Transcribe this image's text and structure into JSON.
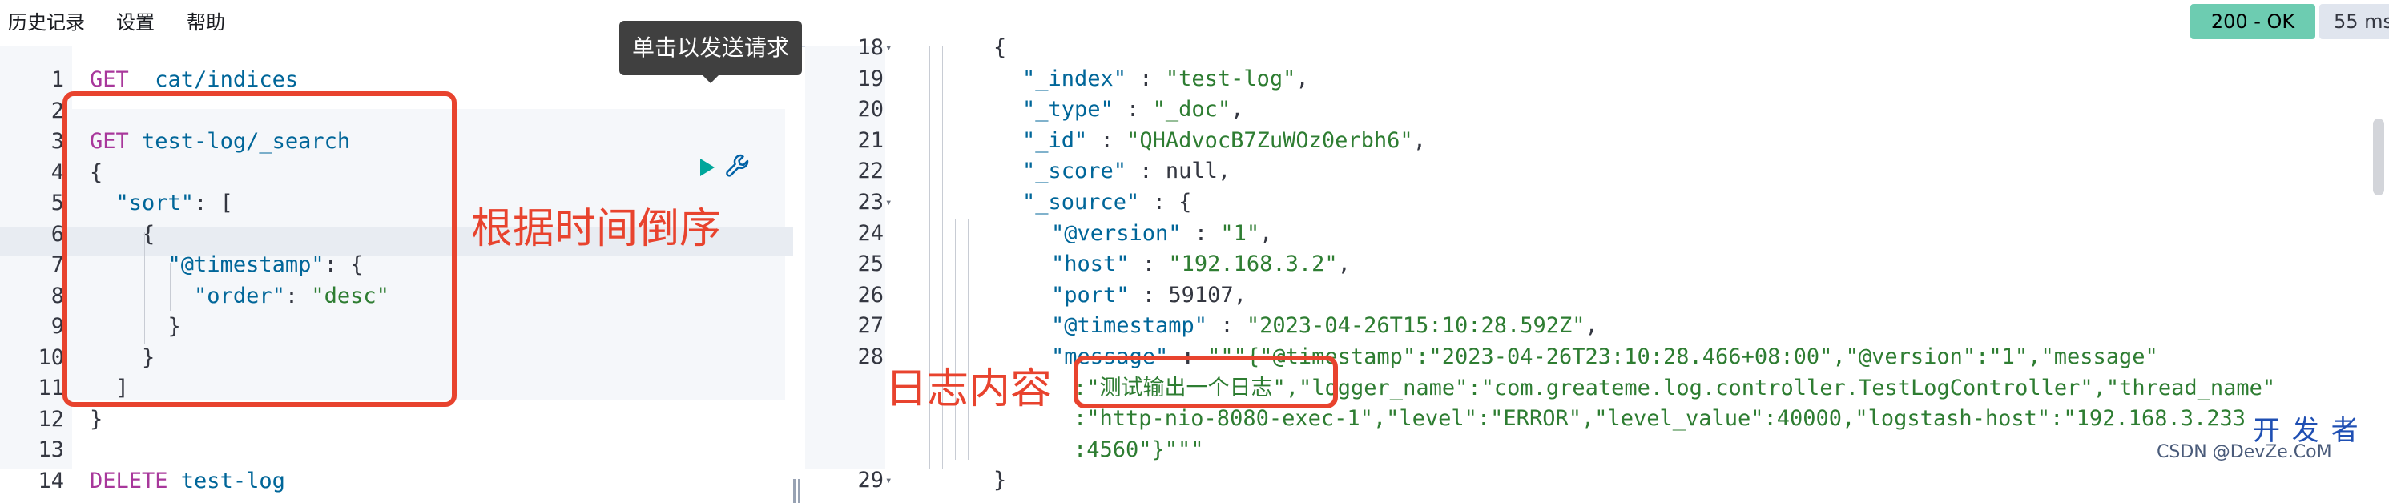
{
  "menu": {
    "history": "历史记录",
    "settings": "设置",
    "help": "帮助"
  },
  "status": {
    "code": "200 - OK",
    "time": "55 ms"
  },
  "tooltip": "单击以发送请求",
  "editor": {
    "lines": [
      {
        "n": "1",
        "segments": [
          {
            "c": "m",
            "t": "GET "
          },
          {
            "c": "str",
            "t": "_cat/indices"
          }
        ]
      },
      {
        "n": "2",
        "segments": []
      },
      {
        "n": "3",
        "segments": [
          {
            "c": "m",
            "t": "GET "
          },
          {
            "c": "str",
            "t": "test-log/_search"
          }
        ]
      },
      {
        "n": "4",
        "segments": [
          {
            "c": "plain",
            "t": "{"
          }
        ]
      },
      {
        "n": "5",
        "segments": [
          {
            "c": "plain",
            "t": "  "
          },
          {
            "c": "key",
            "t": "\"sort\""
          },
          {
            "c": "plain",
            "t": ": ["
          }
        ]
      },
      {
        "n": "6",
        "segments": [
          {
            "c": "plain",
            "t": "    {"
          }
        ]
      },
      {
        "n": "7",
        "segments": [
          {
            "c": "plain",
            "t": "      "
          },
          {
            "c": "key",
            "t": "\"@timestamp\""
          },
          {
            "c": "plain",
            "t": ": {"
          }
        ]
      },
      {
        "n": "8",
        "segments": [
          {
            "c": "plain",
            "t": "        "
          },
          {
            "c": "key",
            "t": "\"order\""
          },
          {
            "c": "plain",
            "t": ": "
          },
          {
            "c": "tval",
            "t": "\"desc\""
          }
        ]
      },
      {
        "n": "9",
        "segments": [
          {
            "c": "plain",
            "t": "      }"
          }
        ]
      },
      {
        "n": "10",
        "segments": [
          {
            "c": "plain",
            "t": "    }"
          }
        ]
      },
      {
        "n": "11",
        "segments": [
          {
            "c": "plain",
            "t": "  ]"
          }
        ]
      },
      {
        "n": "12",
        "segments": [
          {
            "c": "plain",
            "t": "}"
          }
        ]
      },
      {
        "n": "13",
        "segments": []
      },
      {
        "n": "14",
        "segments": [
          {
            "c": "m",
            "t": "DELETE "
          },
          {
            "c": "str",
            "t": "test-log"
          }
        ]
      }
    ]
  },
  "response": {
    "lines": [
      {
        "n": "18",
        "fold": true,
        "segments": [
          {
            "c": "plain",
            "t": "{"
          }
        ]
      },
      {
        "n": "19",
        "segments": [
          {
            "c": "rkey",
            "t": "\"_index\""
          },
          {
            "c": "plain",
            "t": " : "
          },
          {
            "c": "tval",
            "t": "\"test-log\""
          },
          {
            "c": "plain",
            "t": ","
          }
        ]
      },
      {
        "n": "20",
        "segments": [
          {
            "c": "rkey",
            "t": "\"_type\""
          },
          {
            "c": "plain",
            "t": " : "
          },
          {
            "c": "tval",
            "t": "\"_doc\""
          },
          {
            "c": "plain",
            "t": ","
          }
        ]
      },
      {
        "n": "21",
        "segments": [
          {
            "c": "rkey",
            "t": "\"_id\""
          },
          {
            "c": "plain",
            "t": " : "
          },
          {
            "c": "tval",
            "t": "\"QHAdvocB7ZuWOz0erbh6\""
          },
          {
            "c": "plain",
            "t": ","
          }
        ]
      },
      {
        "n": "22",
        "segments": [
          {
            "c": "rkey",
            "t": "\"_score\""
          },
          {
            "c": "plain",
            "t": " : null,"
          }
        ]
      },
      {
        "n": "23",
        "fold": true,
        "segments": [
          {
            "c": "rkey",
            "t": "\"_source\""
          },
          {
            "c": "plain",
            "t": " : {"
          }
        ]
      },
      {
        "n": "24",
        "segments": [
          {
            "c": "rkey",
            "t": "\"@version\""
          },
          {
            "c": "plain",
            "t": " : "
          },
          {
            "c": "tval",
            "t": "\"1\""
          },
          {
            "c": "plain",
            "t": ","
          }
        ]
      },
      {
        "n": "25",
        "segments": [
          {
            "c": "rkey",
            "t": "\"host\""
          },
          {
            "c": "plain",
            "t": " : "
          },
          {
            "c": "tval",
            "t": "\"192.168.3.2\""
          },
          {
            "c": "plain",
            "t": ","
          }
        ]
      },
      {
        "n": "26",
        "segments": [
          {
            "c": "rkey",
            "t": "\"port\""
          },
          {
            "c": "plain",
            "t": " : 59107,"
          }
        ]
      },
      {
        "n": "27",
        "segments": [
          {
            "c": "rkey",
            "t": "\"@timestamp\""
          },
          {
            "c": "plain",
            "t": " : "
          },
          {
            "c": "tval",
            "t": "\"2023-04-26T15:10:28.592Z\""
          },
          {
            "c": "plain",
            "t": ","
          }
        ]
      },
      {
        "n": "28",
        "segments": [
          {
            "c": "rkey",
            "t": "\"message\""
          },
          {
            "c": "plain",
            "t": " : "
          },
          {
            "c": "tval",
            "t": "\"\"\"{\"@timestamp\":\"2023-04-26T23:10:28.466+08:00\",\"@version\":\"1\",\"message\""
          }
        ]
      },
      {
        "n": "",
        "segments": [
          {
            "c": "tval",
            "t": ":\"测试输出一个日志\",\"logger_name\":\"com.greateme.log.controller.TestLogController\",\"thread_name\""
          }
        ]
      },
      {
        "n": "",
        "segments": [
          {
            "c": "tval",
            "t": ":\"http-nio-8080-exec-1\",\"level\":\"ERROR\",\"level_value\":40000,\"logstash-host\":\"192.168.3.233"
          }
        ]
      },
      {
        "n": "",
        "segments": [
          {
            "c": "tval",
            "t": ":4560\"}\"\"\""
          }
        ]
      },
      {
        "n": "29",
        "fold": true,
        "segments": [
          {
            "c": "plain",
            "t": "}"
          }
        ]
      }
    ]
  },
  "annotations": {
    "sort_desc": "根据时间倒序",
    "log_content": "日志内容"
  },
  "watermark": {
    "line1": "开 发 者",
    "line2": "CSDN @DevZe.CoM"
  }
}
